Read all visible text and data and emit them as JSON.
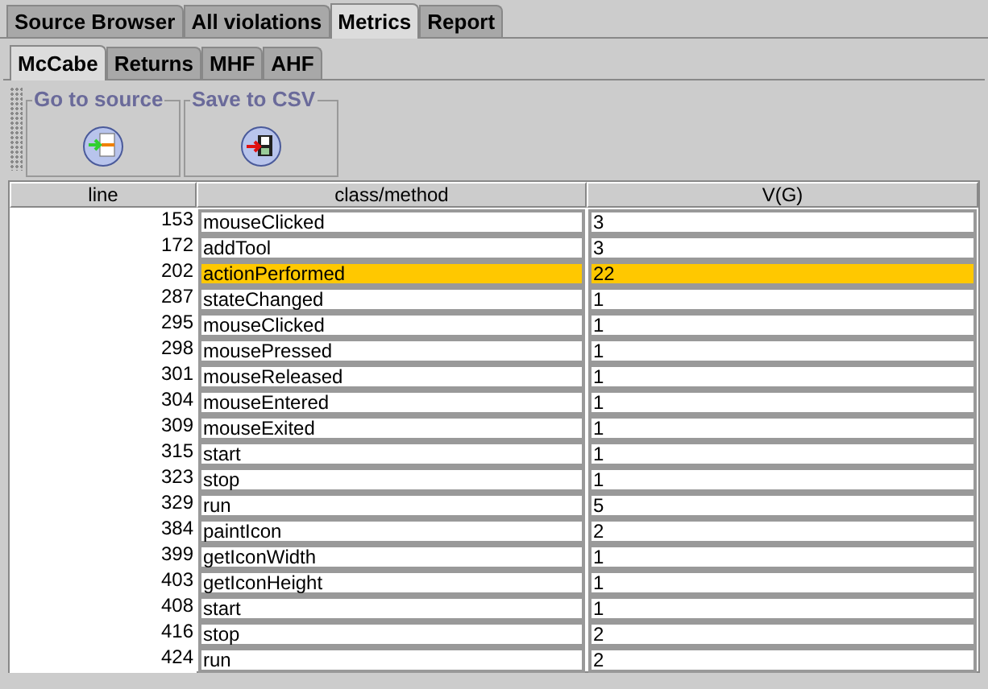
{
  "tabs": [
    {
      "label": "Source Browser",
      "selected": false
    },
    {
      "label": "All violations",
      "selected": false
    },
    {
      "label": "Metrics",
      "selected": true
    },
    {
      "label": "Report",
      "selected": false
    }
  ],
  "subtabs": [
    {
      "label": "McCabe",
      "selected": true
    },
    {
      "label": "Returns",
      "selected": false
    },
    {
      "label": "MHF",
      "selected": false
    },
    {
      "label": "AHF",
      "selected": false
    }
  ],
  "toolbar": [
    {
      "label": "Go to source",
      "kind": "source"
    },
    {
      "label": "Save to CSV",
      "kind": "save"
    }
  ],
  "table": {
    "columns": [
      "line",
      "class/method",
      "V(G)"
    ],
    "rows": [
      {
        "line": "153",
        "method": "mouseClicked",
        "vg": "3",
        "selected": false
      },
      {
        "line": "172",
        "method": "addTool",
        "vg": "3",
        "selected": false
      },
      {
        "line": "202",
        "method": "actionPerformed",
        "vg": "22",
        "selected": true
      },
      {
        "line": "287",
        "method": "stateChanged",
        "vg": "1",
        "selected": false
      },
      {
        "line": "295",
        "method": "mouseClicked",
        "vg": "1",
        "selected": false
      },
      {
        "line": "298",
        "method": "mousePressed",
        "vg": "1",
        "selected": false
      },
      {
        "line": "301",
        "method": "mouseReleased",
        "vg": "1",
        "selected": false
      },
      {
        "line": "304",
        "method": "mouseEntered",
        "vg": "1",
        "selected": false
      },
      {
        "line": "309",
        "method": "mouseExited",
        "vg": "1",
        "selected": false
      },
      {
        "line": "315",
        "method": "start",
        "vg": "1",
        "selected": false
      },
      {
        "line": "323",
        "method": "stop",
        "vg": "1",
        "selected": false
      },
      {
        "line": "329",
        "method": "run",
        "vg": "5",
        "selected": false
      },
      {
        "line": "384",
        "method": "paintIcon",
        "vg": "2",
        "selected": false
      },
      {
        "line": "399",
        "method": "getIconWidth",
        "vg": "1",
        "selected": false
      },
      {
        "line": "403",
        "method": "getIconHeight",
        "vg": "1",
        "selected": false
      },
      {
        "line": "408",
        "method": "start",
        "vg": "1",
        "selected": false
      },
      {
        "line": "416",
        "method": "stop",
        "vg": "2",
        "selected": false
      },
      {
        "line": "424",
        "method": "run",
        "vg": "2",
        "selected": false
      }
    ]
  }
}
